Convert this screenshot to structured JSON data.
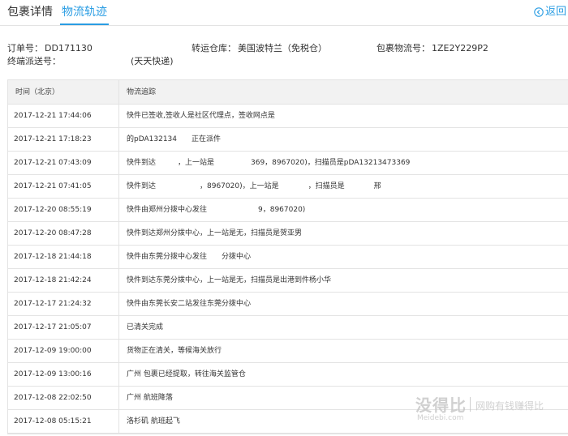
{
  "tabs": {
    "detail": "包裹详情",
    "tracking": "物流轨迹",
    "back": "返回"
  },
  "info": {
    "order_label": "订单号：",
    "order_value": "DD171130",
    "warehouse_label": "转运仓库：",
    "warehouse_value": "美国波特兰（免税仓）",
    "package_label": "包裹物流号：",
    "package_value": "1ZE2Y229P2",
    "dispatch_label": "终端派送号：",
    "dispatch_value": "",
    "carrier": "(天天快递)"
  },
  "table": {
    "headers": {
      "time": "时间（北京）",
      "desc": "物流追踪"
    },
    "rows": [
      {
        "time": "2017-12-21 17:44:06",
        "desc": "快件已签收,签收人是社区代理点，签收网点是"
      },
      {
        "time": "2017-12-21 17:18:23",
        "desc": "的pDA132134　　正在派件"
      },
      {
        "time": "2017-12-21 07:43:09",
        "desc": "快件到达　　　，上一站是　　　　　369，8967020)，扫描员是pDA13213473369"
      },
      {
        "time": "2017-12-21 07:41:05",
        "desc": "快件到达　　　　　　，8967020)，上一站是　　　　，扫描员是　　　　邢"
      },
      {
        "time": "2017-12-20 08:55:19",
        "desc": "快件由郑州分拨中心发往　　　　　　　9，8967020)"
      },
      {
        "time": "2017-12-20 08:47:28",
        "desc": "快件到达郑州分拨中心，上一站是无，扫描员是贺亚男"
      },
      {
        "time": "2017-12-18 21:44:18",
        "desc": "快件由东莞分拨中心发往　　分拨中心"
      },
      {
        "time": "2017-12-18 21:42:24",
        "desc": "快件到达东莞分拨中心，上一站是无，扫描员是出港到件杨小华"
      },
      {
        "time": "2017-12-17 21:24:32",
        "desc": "快件由东莞长安二站发往东莞分拨中心"
      },
      {
        "time": "2017-12-17 21:05:07",
        "desc": "已清关完成"
      },
      {
        "time": "2017-12-09 19:00:00",
        "desc": "货物正在清关，等候海关放行"
      },
      {
        "time": "2017-12-09 13:00:16",
        "desc": "广州 包裹已经提取，转往海关监管仓"
      },
      {
        "time": "2017-12-08 22:02:50",
        "desc": "广州 航班降落"
      },
      {
        "time": "2017-12-08 05:15:21",
        "desc": "洛杉矶 航班起飞"
      }
    ]
  },
  "watermark": {
    "logo": "没得比",
    "slogan": "网购有钱赚得比",
    "domain": "Meidebi.com"
  },
  "colors": {
    "accent": "#2a9de3",
    "border": "#e3e3e3",
    "header_bg": "#f2f2f2"
  }
}
